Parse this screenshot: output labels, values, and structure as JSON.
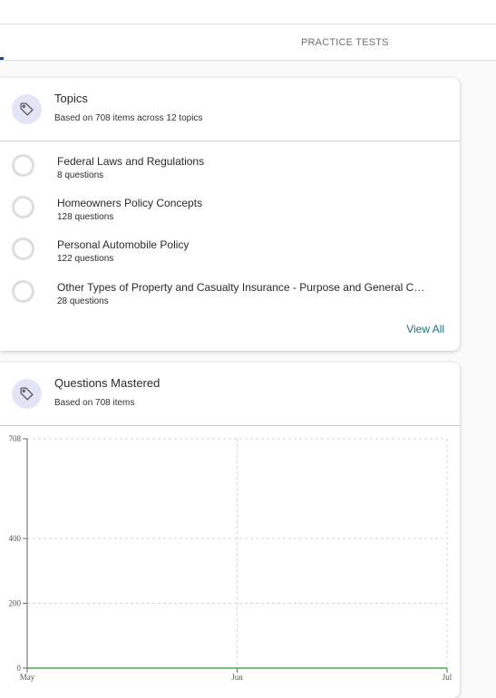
{
  "tabs": {
    "practice_tests": "PRACTICE TESTS"
  },
  "topics_card": {
    "title": "Topics",
    "subtitle": "Based on 708 items across 12 topics",
    "icon": "tag-icon",
    "items": [
      {
        "name": "Federal Laws and Regulations",
        "count": "8 questions"
      },
      {
        "name": "Homeowners Policy Concepts",
        "count": "128 questions"
      },
      {
        "name": "Personal Automobile Policy",
        "count": "122 questions"
      },
      {
        "name": "Other Types of Property and Casualty Insurance - Purpose and General C…",
        "count": "28 questions"
      }
    ],
    "view_all": "View All"
  },
  "mastered_card": {
    "title": "Questions Mastered",
    "subtitle": "Based on 708 items",
    "icon": "tag-icon"
  },
  "colors": {
    "accent": "#1a3fa8",
    "line": "#4caf50",
    "link": "#1f6f86",
    "badge": "#e3e5f7"
  },
  "chart_data": {
    "type": "line",
    "x": [
      "May",
      "Jun",
      "Jul"
    ],
    "series": [
      {
        "values": [
          0,
          0,
          0
        ]
      }
    ],
    "yticks": [
      0,
      200,
      400,
      708
    ],
    "ylim": [
      0,
      708
    ],
    "grid": true
  }
}
